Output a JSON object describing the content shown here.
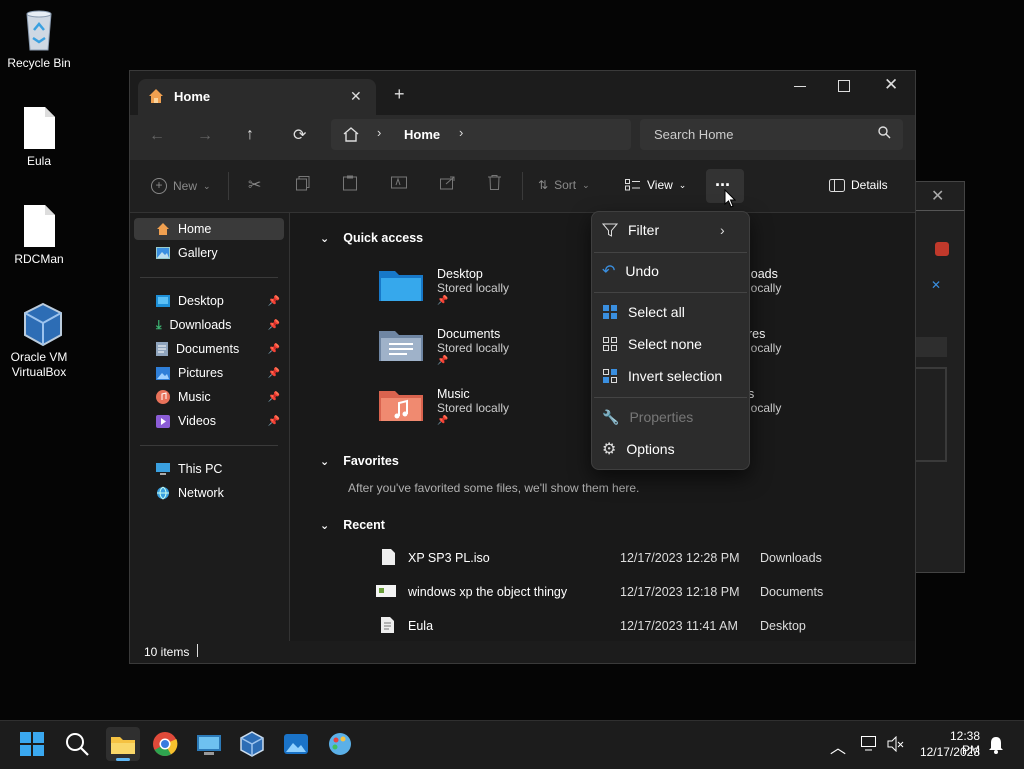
{
  "desktop": {
    "icons": [
      {
        "label": "Recycle Bin",
        "icon": "recycle-bin-icon"
      },
      {
        "label": "Eula",
        "icon": "document-icon"
      },
      {
        "label": "RDCMan",
        "icon": "document-icon"
      },
      {
        "label": "Oracle VM VirtualBox",
        "icon": "virtualbox-icon"
      }
    ]
  },
  "window": {
    "tab_title": "Home",
    "new_tab_symbol": "+",
    "address": {
      "crumb": "Home",
      "search_placeholder": "Search Home"
    },
    "commands": {
      "new": "New",
      "sort": "Sort",
      "view": "View",
      "more": "···",
      "details": "Details"
    },
    "nav": {
      "top": [
        {
          "label": "Home",
          "icon": "home-icon"
        },
        {
          "label": "Gallery",
          "icon": "gallery-icon"
        }
      ],
      "pinned": [
        {
          "label": "Desktop",
          "icon": "desktop-folder-icon"
        },
        {
          "label": "Downloads",
          "icon": "downloads-icon"
        },
        {
          "label": "Documents",
          "icon": "documents-icon"
        },
        {
          "label": "Pictures",
          "icon": "pictures-icon"
        },
        {
          "label": "Music",
          "icon": "music-icon"
        },
        {
          "label": "Videos",
          "icon": "videos-icon"
        }
      ],
      "bottom": [
        {
          "label": "This PC",
          "icon": "pc-icon"
        },
        {
          "label": "Network",
          "icon": "network-icon"
        }
      ]
    },
    "content": {
      "quick_access": {
        "title": "Quick access",
        "items": [
          {
            "name": "Desktop",
            "sub": "Stored locally",
            "icon": "desktop-folder-icon"
          },
          {
            "name": "Documents",
            "sub": "Stored locally",
            "icon": "documents-folder-icon"
          },
          {
            "name": "Music",
            "sub": "Stored locally",
            "icon": "music-folder-icon"
          }
        ],
        "partial_right": [
          {
            "name": "loads",
            "sub": "locally"
          },
          {
            "name": "res",
            "sub": "locally"
          },
          {
            "name": "s",
            "sub": "locally"
          }
        ]
      },
      "favorites": {
        "title": "Favorites",
        "empty": "After you've favorited some files, we'll show them here."
      },
      "recent": {
        "title": "Recent",
        "rows": [
          {
            "name": "XP SP3 PL.iso",
            "date": "12/17/2023 12:28 PM",
            "location": "Downloads",
            "icon": "file-icon"
          },
          {
            "name": "windows xp the object thingy",
            "date": "12/17/2023 12:18 PM",
            "location": "Documents",
            "icon": "image-file-icon"
          },
          {
            "name": "Eula",
            "date": "12/17/2023 11:41 AM",
            "location": "Desktop",
            "icon": "text-file-icon"
          }
        ]
      }
    },
    "status": "10 items"
  },
  "menu": {
    "filter": "Filter",
    "undo": "Undo",
    "select_all": "Select all",
    "select_none": "Select none",
    "invert_selection": "Invert selection",
    "properties": "Properties",
    "options": "Options"
  },
  "taskbar": {
    "time": "12:38 PM",
    "date": "12/17/2023"
  }
}
